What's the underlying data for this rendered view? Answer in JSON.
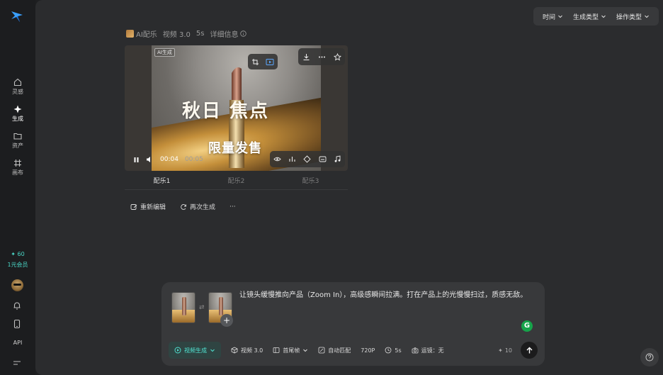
{
  "sidebar": {
    "items": [
      {
        "label": "灵感",
        "icon": "home-icon"
      },
      {
        "label": "生成",
        "icon": "sparkle-icon"
      },
      {
        "label": "资产",
        "icon": "folder-icon"
      },
      {
        "label": "画布",
        "icon": "frame-icon"
      }
    ],
    "credits_value": "✦ 60",
    "credits_plan": "1元会员",
    "api_label": "API"
  },
  "filters": {
    "time": "时间",
    "gen_type": "生成类型",
    "op_type": "操作类型"
  },
  "meta": {
    "music": "AI配乐",
    "model": "视频 3.0",
    "duration": "5s",
    "details": "详细信息"
  },
  "player": {
    "ai_tag": "AI生成",
    "headline": "秋日  焦点",
    "subhead": "限量发售",
    "current_time": "00:04",
    "total_time": "00:05",
    "progress_fraction": 0.8
  },
  "tabs": [
    "配乐1",
    "配乐2",
    "配乐3"
  ],
  "actions": {
    "reedit": "重新编辑",
    "regenerate": "再次生成",
    "more": "···"
  },
  "composer": {
    "prompt": "让镜头缓慢推向产品（Zoom In），高级感瞬间拉满。打在产品上的光慢慢扫过，质感无敌。",
    "mode": "视频生成",
    "model": "视频 3.0",
    "frame_mode": "首尾帧",
    "auto_match": "自动匹配",
    "resolution": "720P",
    "duration": "5s",
    "camera": "运镜：无",
    "cost": "10"
  },
  "colors": {
    "accent": "#4ad7c7",
    "background": "#2b2c2e",
    "sidebar": "#1c1d1f"
  }
}
